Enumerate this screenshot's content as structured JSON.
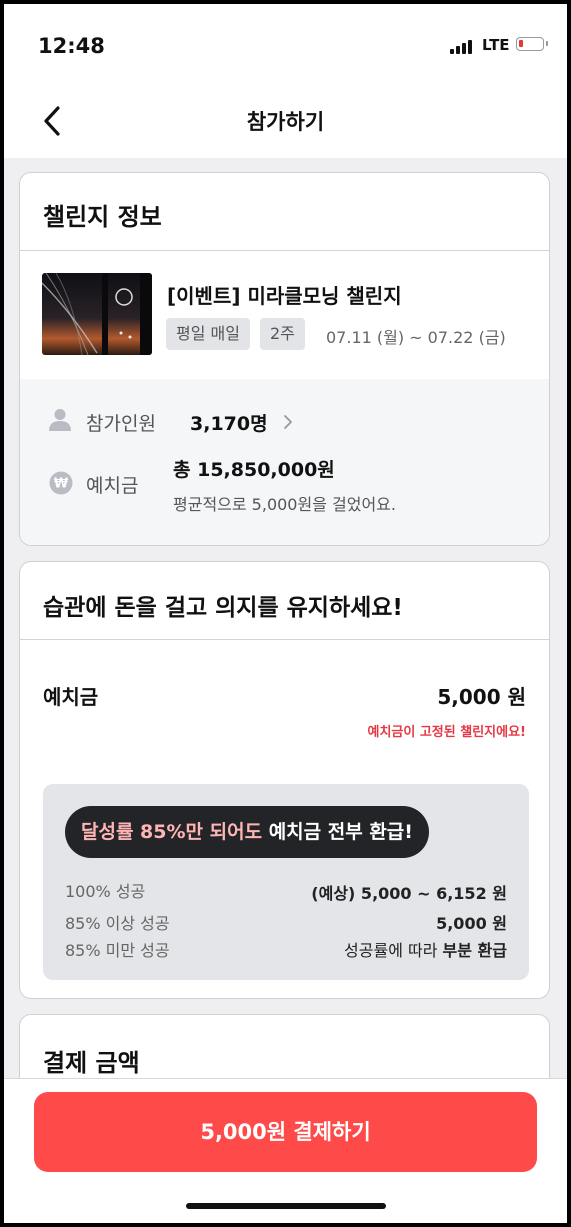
{
  "status_bar": {
    "time": "12:48",
    "network": "LTE"
  },
  "header": {
    "title": "참가하기"
  },
  "challenge_info": {
    "section_title": "챌린지 정보",
    "title": "[이벤트] 미라클모닝 챌린지",
    "tags": [
      "평일 매일",
      "2주"
    ],
    "period": "07.11 (월) ~ 07.22 (금)",
    "participants_label": "참가인원",
    "participants_value": "3,170명",
    "deposit_label": "예치금",
    "deposit_total": "총 15,850,000원",
    "deposit_avg_note": "평균적으로 5,000원을 걸었어요."
  },
  "deposit_section": {
    "section_title": "습관에 돈을 걸고 의지를 유지하세요!",
    "deposit_label": "예치금",
    "deposit_value": "5,000 원",
    "fixed_note": "예치금이 고정된 챌린지에요!",
    "refund_pill": {
      "highlight": "달성률 85%만 되어도",
      "rest": " 예치금 전부 환급!"
    },
    "tiers": [
      {
        "label": "100% 성공",
        "value": "(예상) 5,000 ~ 6,152 원"
      },
      {
        "label": "85% 이상 성공",
        "value": "5,000 원"
      },
      {
        "label": "85% 미만 성공",
        "value_prefix": "성공률에 따라 ",
        "value_bold": "부분 환급"
      }
    ]
  },
  "payment_section": {
    "section_title": "결제 금액"
  },
  "cta": {
    "label": "5,000원 결제하기"
  },
  "colors": {
    "accent": "#ff4a4a",
    "warning_text": "#e53945",
    "pill_bg": "#232427",
    "pill_highlight": "#ffb5b5"
  }
}
